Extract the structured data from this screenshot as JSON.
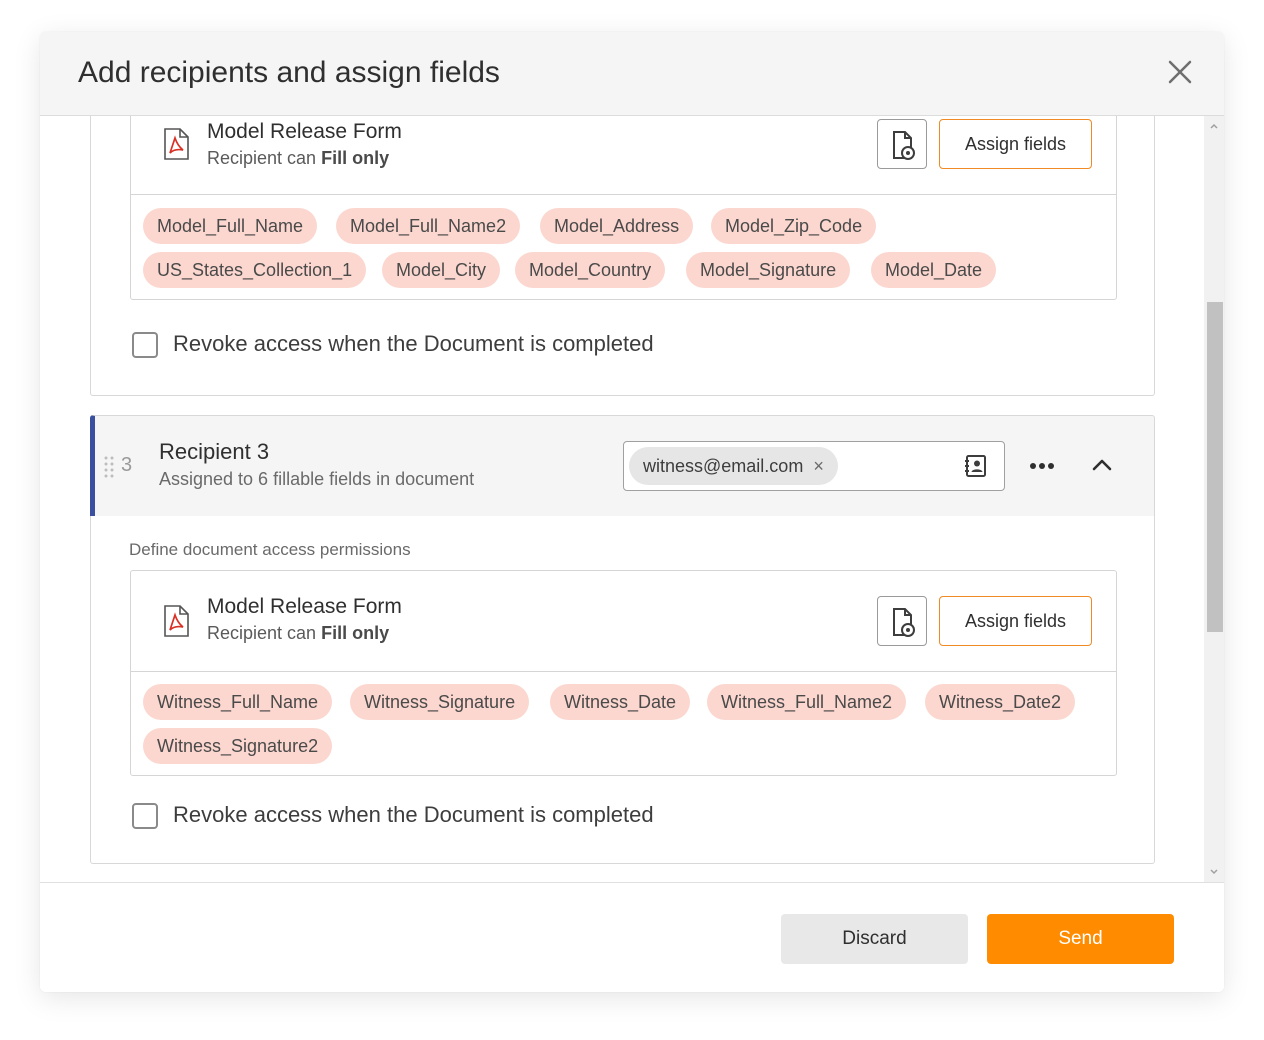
{
  "modal": {
    "title": "Add recipients and assign fields"
  },
  "recipient_prev": {
    "document": {
      "name": "Model Release Form",
      "permission_prefix": "Recipient can",
      "permission_value": "Fill only",
      "assign_label": "Assign fields"
    },
    "fields": [
      "Model_Full_Name",
      "Model_Full_Name2",
      "Model_Address",
      "Model_Zip_Code",
      "US_States_Collection_1",
      "Model_City",
      "Model_Country",
      "Model_Signature",
      "Model_Date"
    ],
    "revoke_label": "Revoke access when the Document is completed"
  },
  "recipient3": {
    "number": "3",
    "name": "Recipient 3",
    "subtitle": "Assigned to 6 fillable fields in document",
    "email": "witness@email.com",
    "email_remove": "×",
    "permissions_heading": "Define document access permissions",
    "document": {
      "name": "Model Release Form",
      "permission_prefix": "Recipient can",
      "permission_value": "Fill only",
      "assign_label": "Assign fields"
    },
    "fields": [
      "Witness_Full_Name",
      "Witness_Signature",
      "Witness_Date",
      "Witness_Full_Name2",
      "Witness_Date2",
      "Witness_Signature2"
    ],
    "revoke_label": "Revoke access when the Document is completed"
  },
  "footer": {
    "discard_label": "Discard",
    "send_label": "Send"
  },
  "colors": {
    "accent": "#ff8c00",
    "chip_bg": "#fcd7cf",
    "recipient_marker": "#3b4fa0",
    "pdf_red": "#d93025"
  },
  "icons": {
    "close": "close-icon",
    "pdf": "pdf-file-icon",
    "doc_settings": "document-settings-icon",
    "contacts": "contacts-book-icon",
    "more": "more-horizontal-icon",
    "collapse": "chevron-up-icon",
    "drag": "drag-handle-icon"
  }
}
